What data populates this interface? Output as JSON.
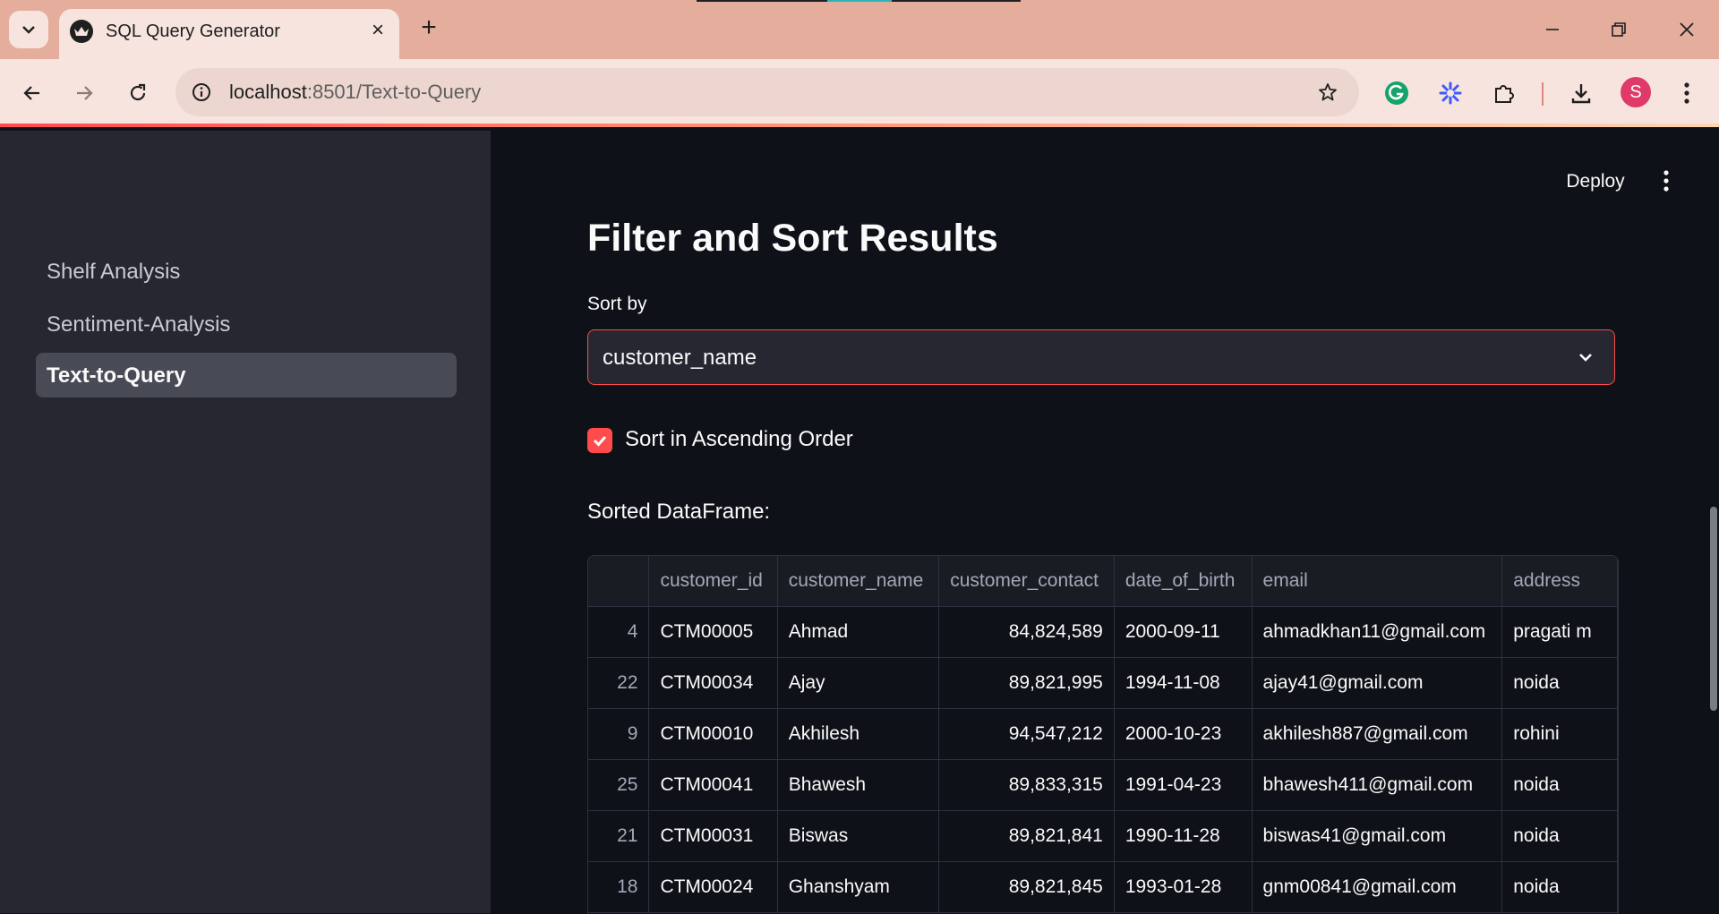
{
  "browser": {
    "tab_title": "SQL Query Generator",
    "url_host": "localhost",
    "url_rest": ":8501/Text-to-Query",
    "avatar_letter": "S"
  },
  "sidebar": {
    "items": [
      {
        "label": "Shelf Analysis",
        "active": false
      },
      {
        "label": "Sentiment-Analysis",
        "active": false
      },
      {
        "label": "Text-to-Query",
        "active": true
      }
    ]
  },
  "header": {
    "deploy_label": "Deploy"
  },
  "main": {
    "title": "Filter and Sort Results",
    "sort_label": "Sort by",
    "sort_value": "customer_name",
    "ascending_label": "Sort in Ascending Order",
    "ascending_checked": true,
    "dataframe_label": "Sorted DataFrame:"
  },
  "table": {
    "columns": [
      "",
      "customer_id",
      "customer_name",
      "customer_contact",
      "date_of_birth",
      "email",
      "address"
    ],
    "rows": [
      [
        "4",
        "CTM00005",
        "Ahmad",
        "84,824,589",
        "2000-09-11",
        "ahmadkhan11@gmail.com",
        "pragati m"
      ],
      [
        "22",
        "CTM00034",
        "Ajay",
        "89,821,995",
        "1994-11-08",
        "ajay41@gmail.com",
        "noida"
      ],
      [
        "9",
        "CTM00010",
        "Akhilesh",
        "94,547,212",
        "2000-10-23",
        "akhilesh887@gmail.com",
        "rohini"
      ],
      [
        "25",
        "CTM00041",
        "Bhawesh",
        "89,833,315",
        "1991-04-23",
        "bhawesh411@gmail.com",
        "noida"
      ],
      [
        "21",
        "CTM00031",
        "Biswas",
        "89,821,841",
        "1990-11-28",
        "biswas41@gmail.com",
        "noida"
      ],
      [
        "18",
        "CTM00024",
        "Ghanshyam",
        "89,821,845",
        "1993-01-28",
        "gnm00841@gmail.com",
        "noida"
      ]
    ]
  },
  "colors": {
    "accent": "#ff4b4b",
    "sidebar_bg": "#262730",
    "main_bg": "#0e1117",
    "chrome_bg": "#e5ad9c"
  }
}
